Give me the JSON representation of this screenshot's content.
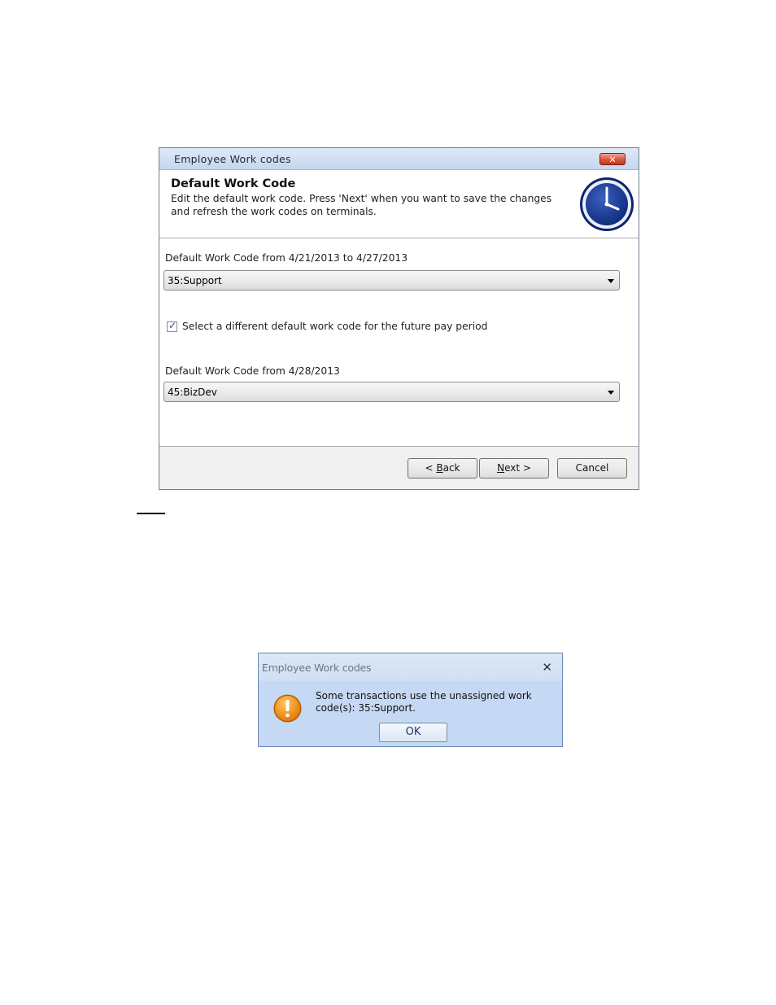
{
  "wizard": {
    "title": "Employee Work codes",
    "close_label": "✕",
    "heading": "Default Work Code",
    "description": "Edit the default work code. Press 'Next' when you want to save the changes and refresh the work codes on terminals.",
    "field1_label": "Default Work Code from 4/21/2013 to 4/27/2013",
    "field1_value": "35:Support",
    "checkbox_label": "Select a different default work code for the future pay period",
    "checkbox_checked": true,
    "field2_label": "Default Work Code from 4/28/2013",
    "field2_value": "45:BizDev",
    "buttons": {
      "back_prefix": "< ",
      "back_key": "B",
      "back_rest": "ack",
      "next_key": "N",
      "next_rest": "ext >",
      "cancel": "Cancel"
    },
    "icon": "clock-icon"
  },
  "message_box": {
    "title": "Employee Work codes",
    "close_label": "✕",
    "text": "Some transactions use the unassigned work code(s): 35:Support.",
    "ok_label": "OK",
    "icon": "warning-icon",
    "accent_color": "#f39200"
  }
}
